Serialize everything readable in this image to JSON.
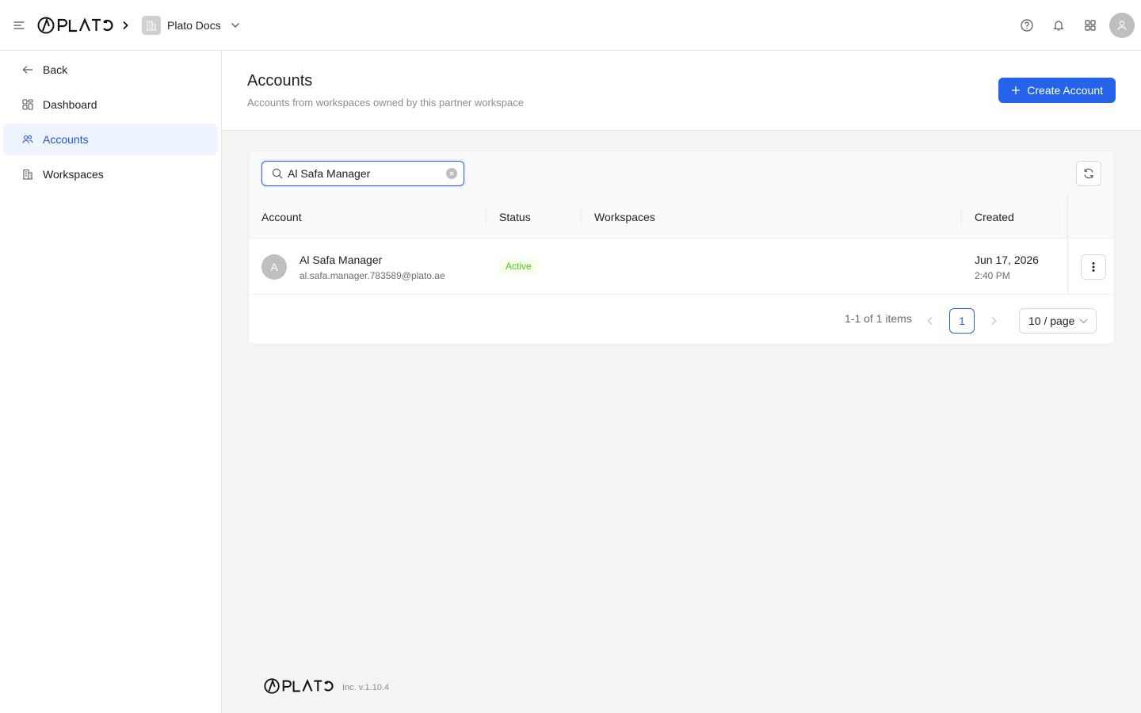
{
  "topbar": {
    "menu_icon": "menu-icon",
    "logo_text": "PLATO",
    "workspace_name": "Plato Docs",
    "icons": [
      "help-circle-icon",
      "bell-icon",
      "apps-grid-icon",
      "user-icon"
    ]
  },
  "sidebar": {
    "items": [
      {
        "label": "Back",
        "icon": "arrow-left-icon",
        "active": false
      },
      {
        "label": "Dashboard",
        "icon": "dashboard-icon",
        "active": false
      },
      {
        "label": "Accounts",
        "icon": "users-icon",
        "active": true
      },
      {
        "label": "Workspaces",
        "icon": "building-icon",
        "active": false
      }
    ]
  },
  "page": {
    "title": "Accounts",
    "subtitle": "Accounts from workspaces owned by this partner workspace",
    "create_button": "Create Account"
  },
  "search": {
    "value": "Al Safa Manager",
    "icon": "search-icon"
  },
  "table": {
    "columns": [
      "Account",
      "Status",
      "Workspaces",
      "Created"
    ],
    "rows": [
      {
        "avatar_initial": "A",
        "name": "Al Safa Manager",
        "email": "al.safa.manager.783589@plato.ae",
        "status": "Active",
        "workspaces": "",
        "created_date": "Jun 17, 2026",
        "created_time": "2:40 PM"
      }
    ]
  },
  "pagination": {
    "total_text": "1-1 of 1 items",
    "current_page": "1",
    "page_size": "10 / page"
  },
  "footer": {
    "logo_text": "PLATO",
    "version": "Inc. v.1.10.4"
  },
  "colors": {
    "primary": "#2563eb",
    "active_bg": "#eef4fd",
    "status_green": "#52c41a",
    "status_green_bg": "#f6ffed"
  }
}
